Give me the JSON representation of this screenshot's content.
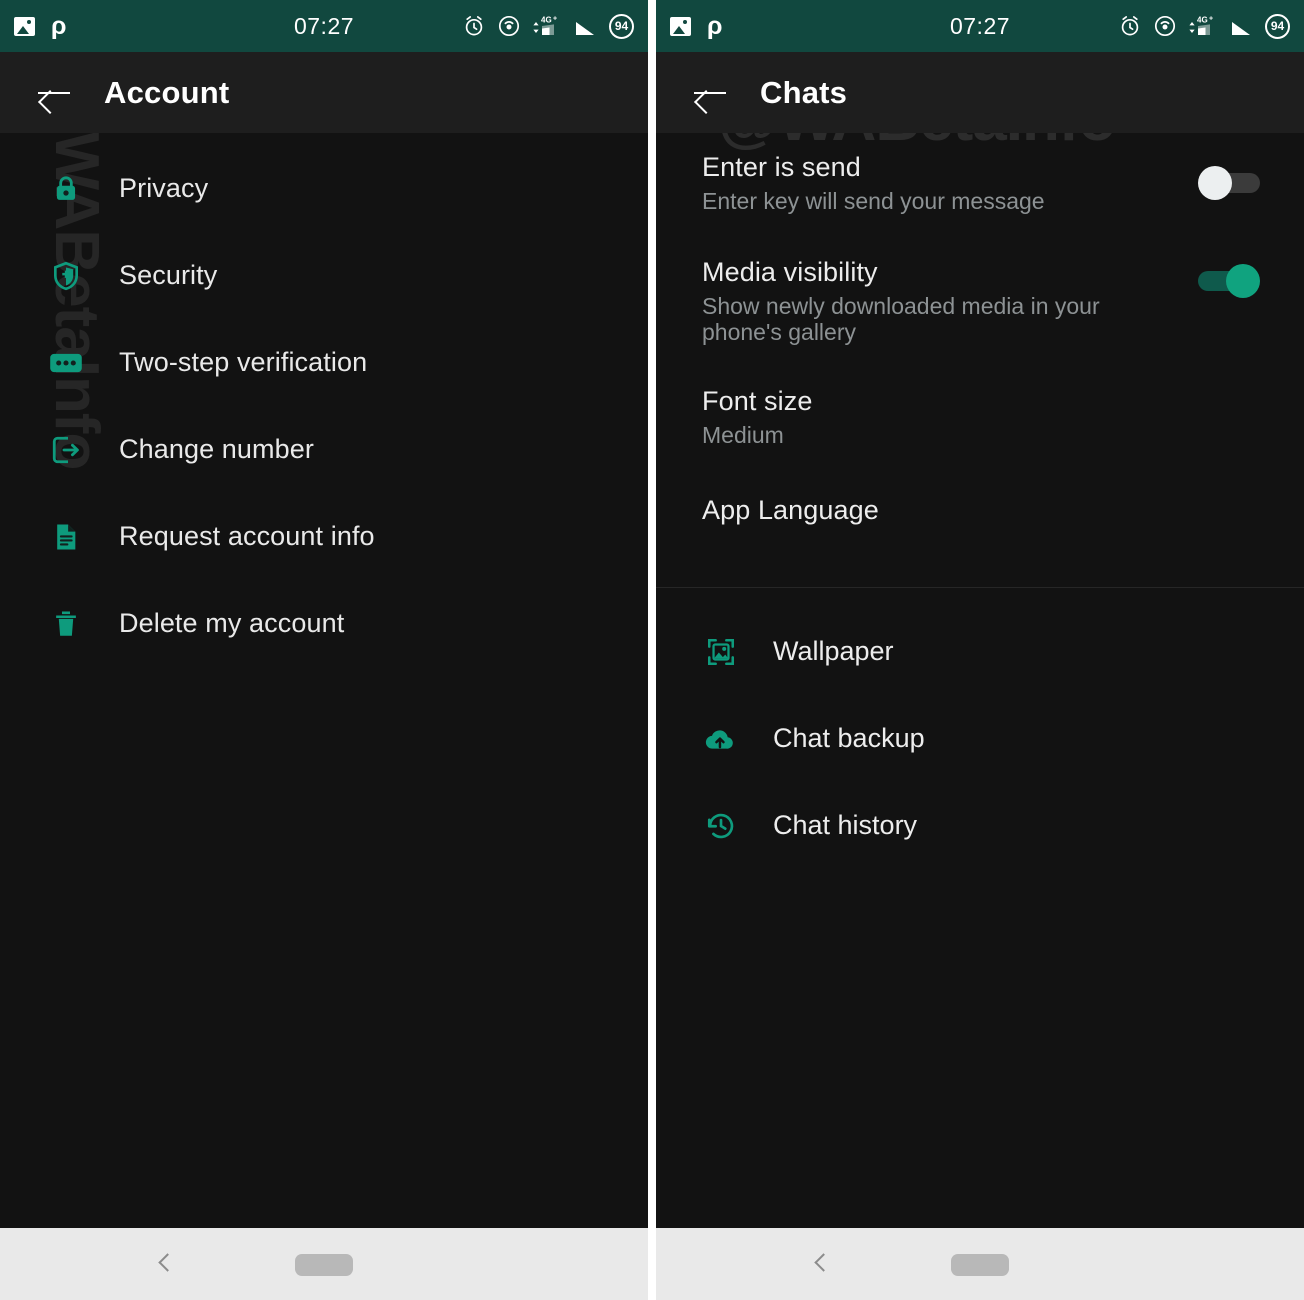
{
  "theme": {
    "status_bar_bg": "#11483f",
    "app_bar_bg": "#1e1e1e",
    "body_bg": "#121212",
    "accent_teal": "#10a37f",
    "primary_text": "#ededed",
    "secondary_text": "#8d9294",
    "nav_bar_bg": "#e9e9e9"
  },
  "status_bar": {
    "time": "07:27",
    "battery_level": "94",
    "network_type": "4G+",
    "left_icons": [
      "photo-icon",
      "p-app-icon"
    ],
    "right_icons": [
      "alarm-clock-icon",
      "hotspot-icon",
      "signal-4g-icon",
      "signal-bars-icon",
      "battery-icon"
    ]
  },
  "watermark": {
    "text": "@WABetaInfo"
  },
  "left_screen": {
    "title": "Account",
    "back_icon": "back-arrow-icon",
    "items": [
      {
        "label": "Privacy",
        "icon": "lock-icon"
      },
      {
        "label": "Security",
        "icon": "shield-icon"
      },
      {
        "label": "Two-step verification",
        "icon": "passcode-dots-icon"
      },
      {
        "label": "Change number",
        "icon": "change-number-icon"
      },
      {
        "label": "Request account info",
        "icon": "document-icon"
      },
      {
        "label": "Delete my account",
        "icon": "trash-icon"
      }
    ]
  },
  "right_screen": {
    "title": "Chats",
    "back_icon": "back-arrow-icon",
    "toggle_rows": [
      {
        "title": "Enter is send",
        "subtitle": "Enter key will send your message",
        "state": "off"
      },
      {
        "title": "Media visibility",
        "subtitle": "Show newly downloaded media in your phone's gallery",
        "state": "on"
      }
    ],
    "value_rows": [
      {
        "title": "Font size",
        "subtitle": "Medium"
      },
      {
        "title": "App Language",
        "subtitle": ""
      }
    ],
    "icon_rows": [
      {
        "label": "Wallpaper",
        "icon": "wallpaper-icon"
      },
      {
        "label": "Chat backup",
        "icon": "cloud-upload-icon"
      },
      {
        "label": "Chat history",
        "icon": "history-clock-icon"
      }
    ]
  },
  "nav_bar": {
    "back_icon": "nav-back-chevron-icon",
    "home_icon": "nav-home-pill-icon"
  }
}
